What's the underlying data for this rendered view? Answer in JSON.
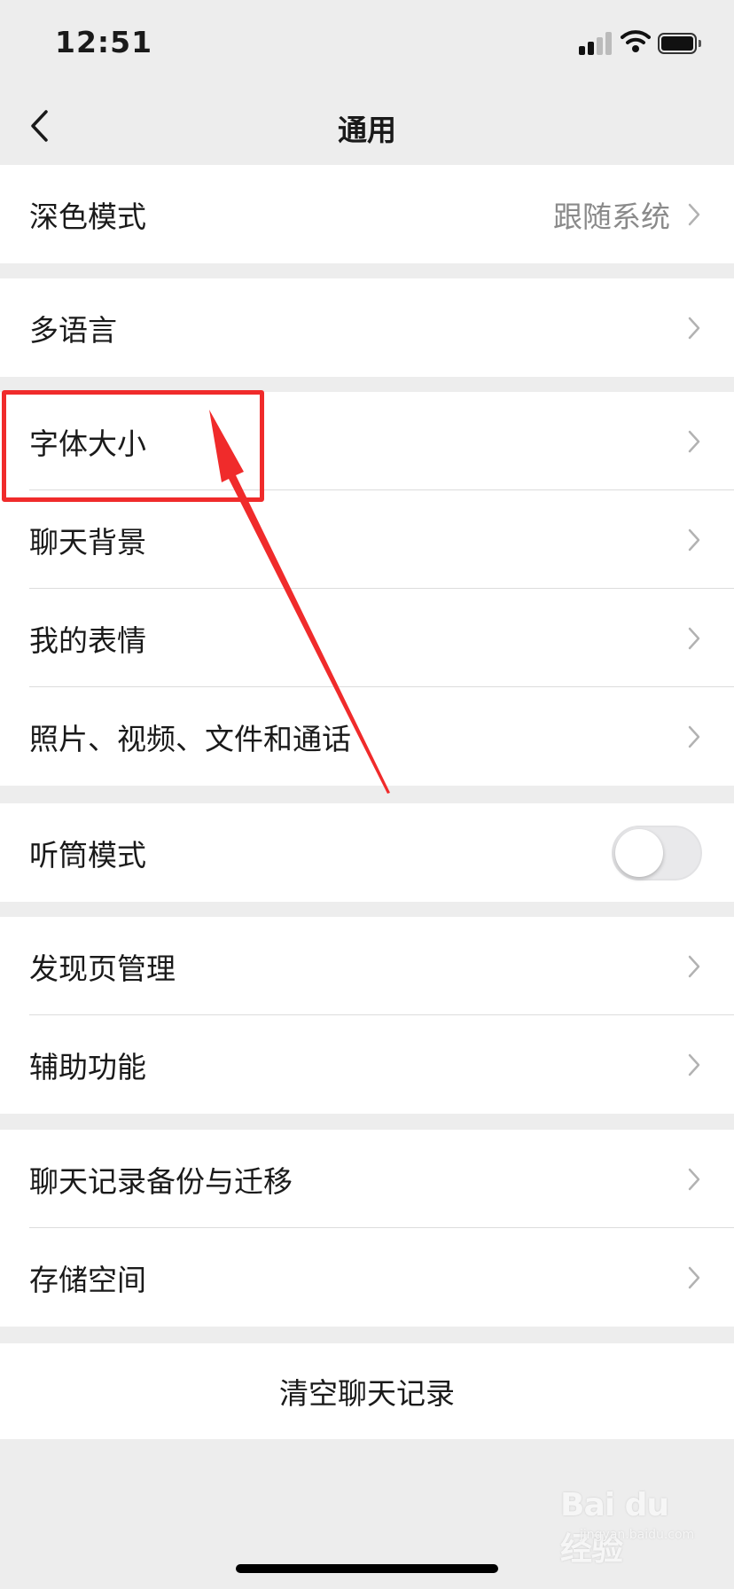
{
  "status_bar": {
    "time": "12:51"
  },
  "nav": {
    "title": "通用"
  },
  "groups": {
    "dark_mode": {
      "label": "深色模式",
      "value": "跟随系统"
    },
    "language": {
      "label": "多语言"
    },
    "display": {
      "items": [
        {
          "label": "字体大小"
        },
        {
          "label": "聊天背景"
        },
        {
          "label": "我的表情"
        },
        {
          "label": "照片、视频、文件和通话"
        }
      ]
    },
    "earpiece": {
      "label": "听筒模式",
      "enabled": false
    },
    "discover": {
      "items": [
        {
          "label": "发现页管理"
        },
        {
          "label": "辅助功能"
        }
      ]
    },
    "storage": {
      "items": [
        {
          "label": "聊天记录备份与迁移"
        },
        {
          "label": "存储空间"
        }
      ]
    },
    "clear": {
      "label": "清空聊天记录"
    }
  },
  "watermark": {
    "brand": "Bai du 经验",
    "url": "jingyan.baidu.com"
  },
  "colors": {
    "annotation": "#f02b2b",
    "background": "#ededed",
    "secondary_text": "#8a8a8a"
  },
  "icons": [
    "back-chevron-icon",
    "chevron-right-icon",
    "signal-icon",
    "wifi-icon",
    "battery-icon"
  ]
}
